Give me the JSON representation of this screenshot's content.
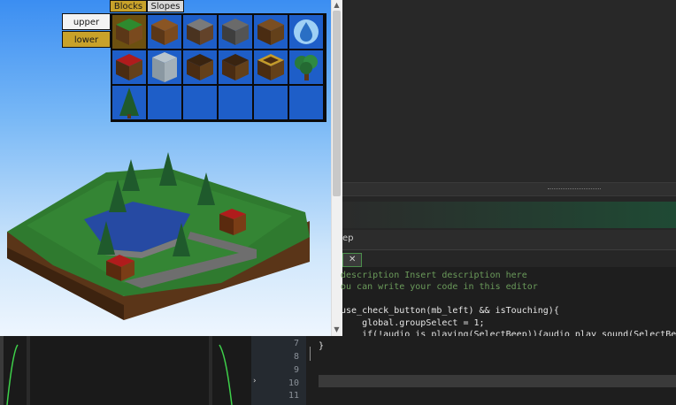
{
  "palette": {
    "tabs": [
      "Blocks",
      "Slopes"
    ],
    "layers": [
      "upper",
      "lower"
    ]
  },
  "tiles": [
    {
      "icon": "grass-block-icon"
    },
    {
      "icon": "dirt-block-icon"
    },
    {
      "icon": "stone-block-icon"
    },
    {
      "icon": "stone-block-dark-icon"
    },
    {
      "icon": "wood-block-icon"
    },
    {
      "icon": "water-drop-icon"
    },
    {
      "icon": "red-roof-block-icon"
    },
    {
      "icon": "brick-building-icon"
    },
    {
      "icon": "dark-wood-block-icon"
    },
    {
      "icon": "dark-wood-block-icon"
    },
    {
      "icon": "crate-block-icon"
    },
    {
      "icon": "oak-tree-icon"
    },
    {
      "icon": "pine-tree-icon"
    },
    {
      "icon": ""
    },
    {
      "icon": ""
    },
    {
      "icon": ""
    },
    {
      "icon": ""
    },
    {
      "icon": ""
    }
  ],
  "editor": {
    "tab_name_fragment": "ep",
    "close_glyph": "✕",
    "code_lines": [
      {
        "text": "description Insert description here"
      },
      {
        "text": "ou can write your code in this editor"
      },
      {
        "text": ""
      },
      {
        "text": "use_check_button(mb_left) && isTouching){"
      },
      {
        "text": "    global.groupSelect = 1;"
      },
      {
        "text": "    if(!audio_is_playing(SelectBeep)){audio_play_sound(SelectBeep"
      },
      {
        "text": "}"
      }
    ],
    "line_numbers": [
      "7",
      "8",
      "9",
      "10",
      "11"
    ]
  }
}
